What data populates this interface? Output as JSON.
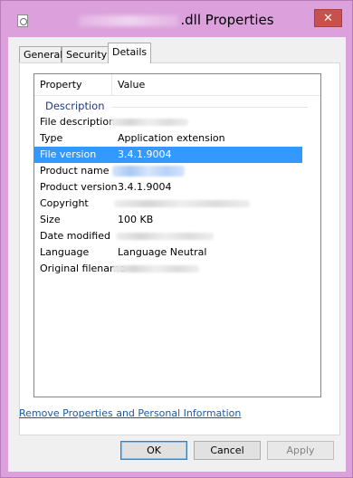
{
  "window": {
    "title_suffix": ".dll Properties",
    "close_label": "✕"
  },
  "tabs": [
    {
      "label": "General",
      "active": false
    },
    {
      "label": "Security",
      "active": false
    },
    {
      "label": "Details",
      "active": true
    }
  ],
  "details": {
    "columns": {
      "property": "Property",
      "value": "Value"
    },
    "group": "Description",
    "rows": [
      {
        "property": "File description",
        "value": "",
        "redacted": true
      },
      {
        "property": "Type",
        "value": "Application extension",
        "redacted": false
      },
      {
        "property": "File version",
        "value": "3.4.1.9004",
        "redacted": false,
        "selected": true
      },
      {
        "property": "Product name",
        "value": "",
        "redacted": true
      },
      {
        "property": "Product version",
        "value": "3.4.1.9004",
        "redacted": false
      },
      {
        "property": "Copyright",
        "value": "",
        "redacted": true
      },
      {
        "property": "Size",
        "value": "100 KB",
        "redacted": false
      },
      {
        "property": "Date modified",
        "value": "",
        "redacted": true
      },
      {
        "property": "Language",
        "value": "Language Neutral",
        "redacted": false
      },
      {
        "property": "Original filename",
        "value": "",
        "redacted": true
      }
    ]
  },
  "link": {
    "label": "Remove Properties and Personal Information"
  },
  "buttons": {
    "ok": "OK",
    "cancel": "Cancel",
    "apply": "Apply"
  },
  "colors": {
    "frame": "#dca1dc",
    "close": "#c7524d",
    "selection": "#3399ff",
    "link": "#1a5aa0"
  },
  "icons": {
    "app": "dll-file-icon",
    "close": "close-icon"
  }
}
